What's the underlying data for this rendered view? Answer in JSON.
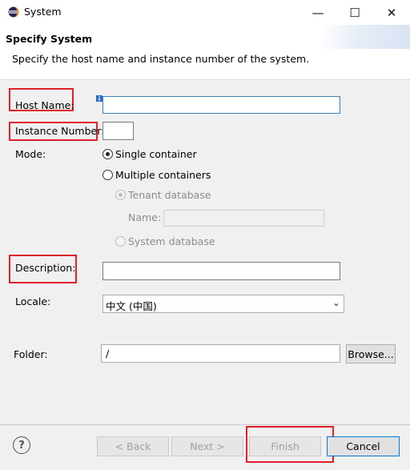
{
  "window": {
    "title": "System",
    "minimize_glyph": "—",
    "maximize_glyph": "☐",
    "close_glyph": "✕"
  },
  "header": {
    "title": "Specify System",
    "description": "Specify the host name and instance number of the system."
  },
  "form": {
    "host_name_label": "Host Name:",
    "host_name_value": "",
    "instance_number_label": "Instance Number:",
    "instance_number_value": "",
    "mode_label": "Mode:",
    "mode_options": [
      {
        "label": "Single container",
        "selected": true,
        "enabled": true
      },
      {
        "label": "Multiple containers",
        "selected": false,
        "enabled": true
      }
    ],
    "tenant_options": [
      {
        "label": "Tenant database",
        "selected": true,
        "enabled": false
      },
      {
        "label": "System database",
        "selected": false,
        "enabled": false
      }
    ],
    "name_label": "Name:",
    "name_value": "",
    "description_label": "Description:",
    "description_value": "",
    "locale_label": "Locale:",
    "locale_value": "中文 (中国)",
    "folder_label": "Folder:",
    "folder_value": "/",
    "browse_label": "Browse..."
  },
  "footer": {
    "help_glyph": "?",
    "back_label": "< Back",
    "next_label": "Next >",
    "finish_label": "Finish",
    "cancel_label": "Cancel"
  },
  "colors": {
    "highlight_red": "#e0202a",
    "focus_blue": "#3c7fb1",
    "dialog_bg": "#f0f0f0"
  },
  "icons": [
    "eclipse-app-icon",
    "info-decoration-icon",
    "help-icon",
    "chevron-down-icon"
  ]
}
